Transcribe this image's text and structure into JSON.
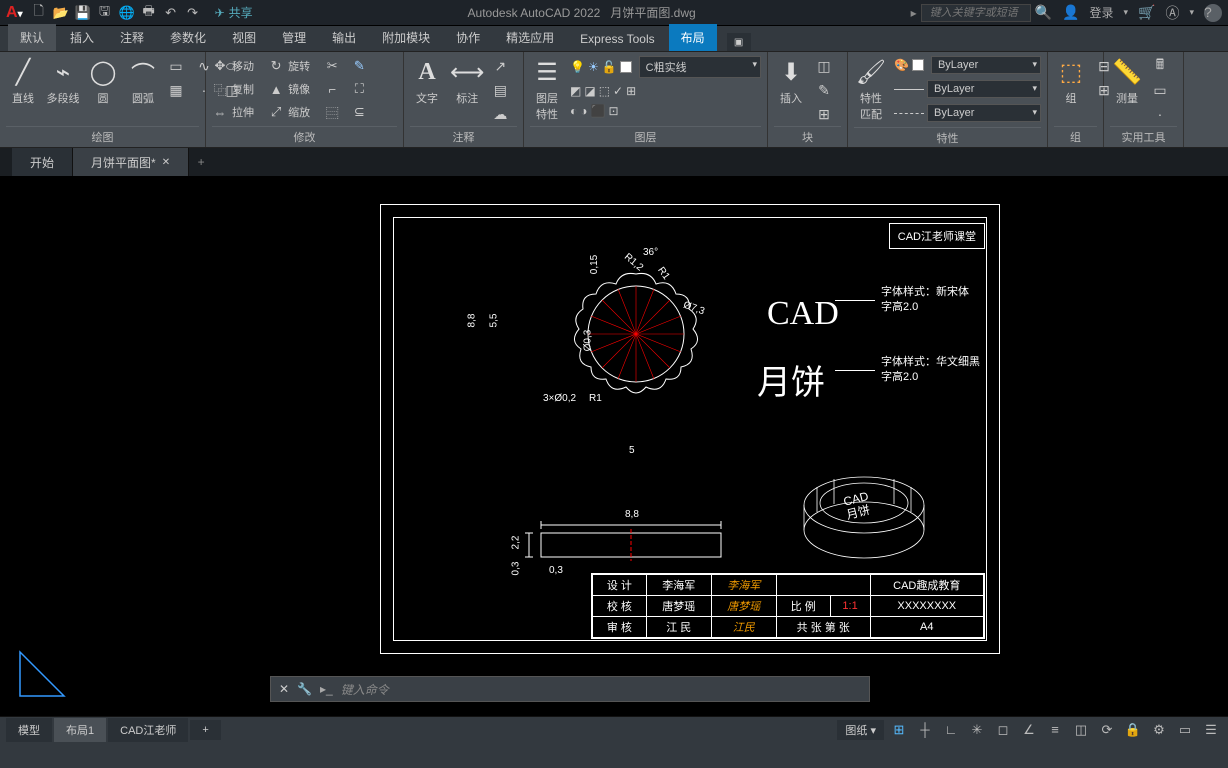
{
  "titlebar": {
    "app": "Autodesk AutoCAD 2022",
    "file": "月饼平面图.dwg",
    "share": "共享",
    "search_ph": "键入关键字或短语",
    "login": "登录"
  },
  "menus": [
    "默认",
    "插入",
    "注释",
    "参数化",
    "视图",
    "管理",
    "输出",
    "附加模块",
    "协作",
    "精选应用",
    "Express Tools",
    "布局"
  ],
  "menu_active": 11,
  "menu_highlight": 0,
  "ribbon": {
    "draw": {
      "title": "绘图",
      "line": "直线",
      "pline": "多段线",
      "circle": "圆",
      "arc": "圆弧"
    },
    "modify": {
      "title": "修改",
      "move": "移动",
      "copy": "复制",
      "stretch": "拉伸",
      "rotate": "旋转",
      "mirror": "镜像",
      "scale": "缩放"
    },
    "anno": {
      "title": "注释",
      "text": "文字",
      "dim": "标注"
    },
    "layer": {
      "title": "图层",
      "prop": "图层\n特性",
      "current": "C粗实线"
    },
    "block": {
      "title": "块",
      "insert": "插入"
    },
    "props": {
      "title": "特性",
      "match": "特性\n匹配",
      "bylayer": "ByLayer"
    },
    "group": {
      "title": "组",
      "label": "组"
    },
    "util": {
      "title": "实用工具",
      "measure": "测量"
    }
  },
  "filetabs": {
    "start": "开始",
    "current": "月饼平面图*"
  },
  "drawing": {
    "titleblock_label": "CAD江老师课堂",
    "cad": "CAD",
    "mooncake": "月饼",
    "note1a": "字体样式：新宋体",
    "note1b": "字高2.0",
    "note2a": "字体样式：华文细黑",
    "note2b": "字高2.0",
    "dims": {
      "h88": "8,8",
      "h55": "5,5",
      "w5": "5",
      "ang": "36°",
      "r12": "R1,2",
      "r1": "R1",
      "r1b": "R1",
      "d73": "Ø7,3",
      "d03": "Ø0,3",
      "s02": "3×Ø0,2",
      "s015": "0,15",
      "sv_w": "8,8",
      "sv_h": "2,2",
      "sv_t": "0,3",
      "sv_t2": "0,3"
    },
    "table": {
      "r1": [
        "设 计",
        "李海军",
        "",
        "",
        "CAD趣成教育"
      ],
      "r2": [
        "校 核",
        "唐梦瑶",
        "",
        "比 例",
        "1:1",
        "XXXXXXXX"
      ],
      "r3": [
        "审 核",
        "江 民",
        "",
        "共  张 第  张",
        "A4"
      ]
    }
  },
  "cmd": {
    "prompt": "键入命令"
  },
  "status": {
    "model": "模型",
    "layout1": "布局1",
    "teacher": "CAD江老师",
    "paper": "图纸"
  }
}
